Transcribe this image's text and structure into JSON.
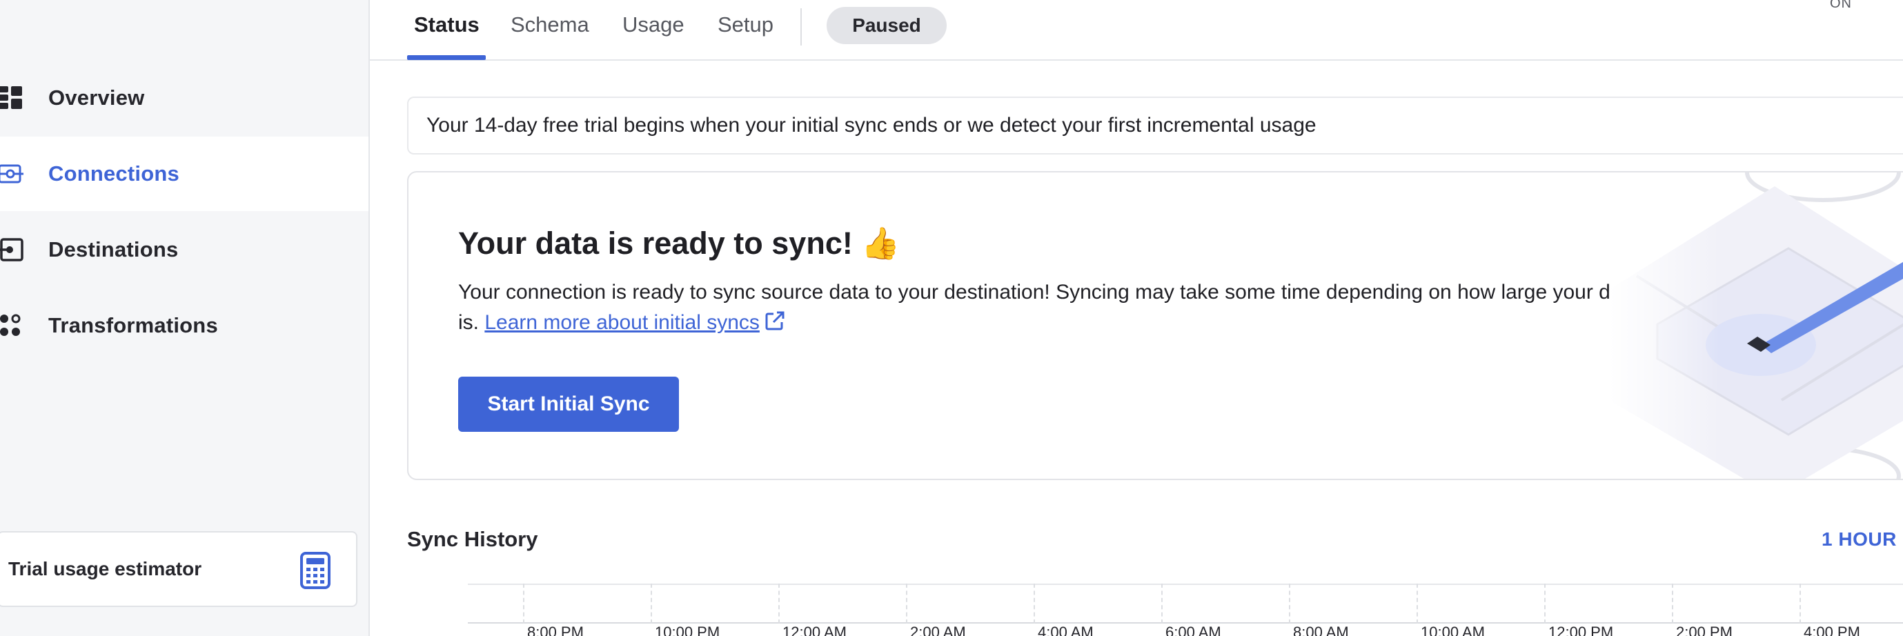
{
  "sidebar": {
    "items": [
      {
        "label": "Overview",
        "icon": "dashboard-grid-icon",
        "active": false
      },
      {
        "label": "Connections",
        "icon": "connections-icon",
        "active": true
      },
      {
        "label": "Destinations",
        "icon": "destination-icon",
        "active": false
      },
      {
        "label": "Transformations",
        "icon": "transformations-icon",
        "active": false
      }
    ],
    "estimator": {
      "label": "Trial usage estimator",
      "icon": "calculator-icon"
    }
  },
  "tabs": [
    {
      "label": "Status",
      "active": true
    },
    {
      "label": "Schema",
      "active": false
    },
    {
      "label": "Usage",
      "active": false
    },
    {
      "label": "Setup",
      "active": false
    }
  ],
  "status_badge": "Paused",
  "toggle_state": "ON",
  "trial_banner": "Your 14-day free trial begins when your initial sync ends or we detect your first incremental usage",
  "ready_card": {
    "title": "Your data is ready to sync! 👍",
    "body": "Your connection is ready to sync source data to your destination! Syncing may take some time depending on how large your data set is. ",
    "link": "Learn more about initial syncs",
    "button": "Start Initial Sync"
  },
  "sync_history": {
    "title": "Sync History",
    "range": "1 HOUR",
    "ticks": [
      "8:00 PM",
      "10:00 PM",
      "12:00 AM",
      "2:00 AM",
      "4:00 AM",
      "6:00 AM",
      "8:00 AM",
      "10:00 AM",
      "12:00 PM",
      "2:00 PM",
      "4:00 PM"
    ]
  },
  "colors": {
    "accent": "#3e64d6",
    "sidebar_bg": "#f5f6f8",
    "pill_bg": "#e3e4e8"
  }
}
